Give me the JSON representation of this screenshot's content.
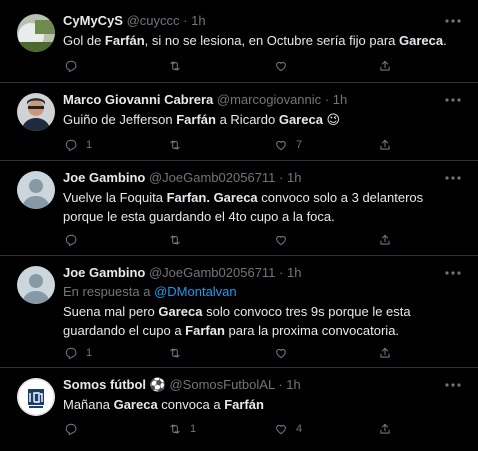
{
  "tweets": [
    {
      "name": "CyMyCyS",
      "handle": "@cuyccc",
      "time": "1h",
      "reply_to": null,
      "text_parts": [
        "Gol de ",
        "Farfán",
        ", si no se lesiona, en Octubre sería fijo para ",
        "Gareca",
        "."
      ],
      "replies": "",
      "retweets": "",
      "likes": ""
    },
    {
      "name": "Marco Giovanni Cabrera",
      "handle": "@marcogiovannic",
      "time": "1h",
      "reply_to": null,
      "text_parts": [
        "Guiño de Jefferson ",
        "Farfán",
        " a Ricardo ",
        "Gareca",
        " 😉"
      ],
      "replies": "1",
      "retweets": "",
      "likes": "7"
    },
    {
      "name": "Joe Gambino",
      "handle": "@JoeGamb02056711",
      "time": "1h",
      "reply_to": null,
      "text_parts": [
        "Vuelve la Foquita ",
        "Farfan.",
        " ",
        "Gareca",
        " convoco solo a 3 delanteros porque le esta guardando el 4to cupo a la foca."
      ],
      "replies": "",
      "retweets": "",
      "likes": ""
    },
    {
      "name": "Joe Gambino",
      "handle": "@JoeGamb02056711",
      "time": "1h",
      "reply_to": {
        "label": "En respuesta a",
        "mention": "@DMontalvan"
      },
      "text_parts": [
        "Suena mal pero ",
        "Gareca",
        " solo convoco tres 9s porque le esta guardando el cupo a ",
        "Farfan",
        " para la proxima convocatoria."
      ],
      "replies": "1",
      "retweets": "",
      "likes": ""
    },
    {
      "name": "Somos fútbol ⚽",
      "handle": "@SomosFutbolAL",
      "time": "1h",
      "reply_to": null,
      "text_parts": [
        "Mañana ",
        "Gareca",
        " convoca a ",
        "Farfán"
      ],
      "replies": "",
      "retweets": "1",
      "likes": "4"
    }
  ],
  "icons": {
    "reply": "reply-icon",
    "retweet": "retweet-icon",
    "like": "heart-icon",
    "share": "share-icon",
    "more": "more-icon"
  },
  "colors": {
    "background": "#000000",
    "text": "#e7e9ea",
    "muted": "#71767b",
    "link": "#1d9bf0",
    "divider": "#2f3336"
  },
  "dot": "·"
}
